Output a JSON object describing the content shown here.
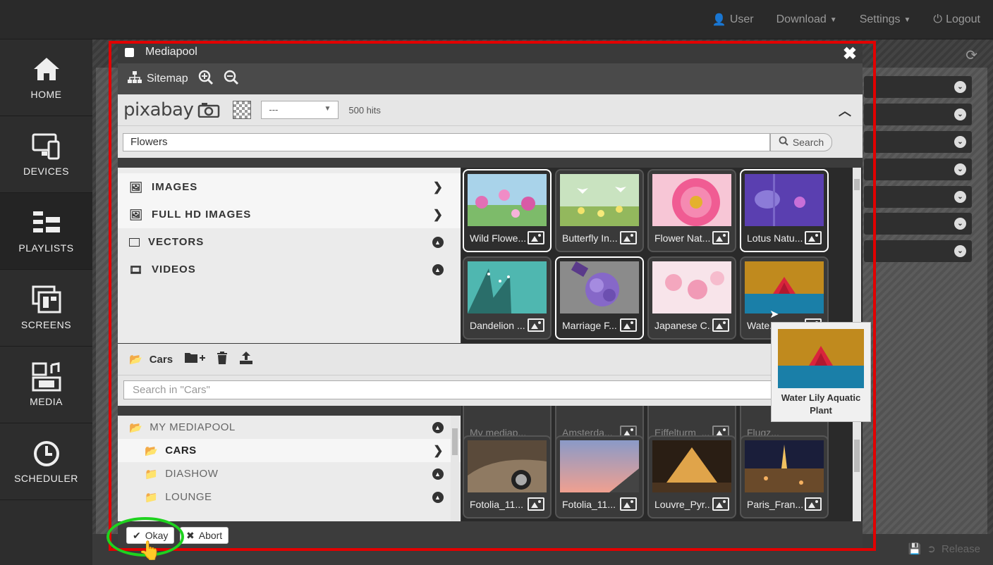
{
  "topnav": {
    "user": "User",
    "download": "Download",
    "settings": "Settings",
    "logout": "Logout"
  },
  "sidebar": {
    "items": [
      {
        "label": "HOME",
        "icon": "home-icon"
      },
      {
        "label": "DEVICES",
        "icon": "devices-icon"
      },
      {
        "label": "PLAYLISTS",
        "icon": "playlists-icon"
      },
      {
        "label": "SCREENS",
        "icon": "screens-icon"
      },
      {
        "label": "MEDIA",
        "icon": "media-icon"
      },
      {
        "label": "SCHEDULER",
        "icon": "scheduler-icon"
      }
    ],
    "active": "PLAYLISTS"
  },
  "modal": {
    "title": "Mediapool",
    "sitemap": "Sitemap",
    "provider": "pixabay",
    "select_value": "---",
    "hits": "500 hits",
    "search_value": "Flowers",
    "search_button": "Search",
    "categories": [
      {
        "label": "IMAGES",
        "icon": "image-icon",
        "state": "right"
      },
      {
        "label": "FULL HD IMAGES",
        "icon": "image-icon",
        "state": "right"
      },
      {
        "label": "VECTORS",
        "icon": "square-icon",
        "state": "up"
      },
      {
        "label": "VIDEOS",
        "icon": "film-icon",
        "state": "up"
      }
    ],
    "results": [
      {
        "label": "Wild Flowe...",
        "selected": true
      },
      {
        "label": "Butterfly In...",
        "selected": false
      },
      {
        "label": "Flower Nat...",
        "selected": false
      },
      {
        "label": "Lotus Natu...",
        "selected": true
      },
      {
        "label": "Dandelion ...",
        "selected": false
      },
      {
        "label": "Marriage F...",
        "selected": true
      },
      {
        "label": "Japanese C...",
        "selected": false
      },
      {
        "label": "Wate...",
        "selected": false
      }
    ],
    "folder_name": "Cars",
    "folder_search_placeholder": "Search in \"Cars\"",
    "tree": [
      {
        "label": "MY MEDIAPOOL",
        "level": 0,
        "state": "up"
      },
      {
        "label": "CARS",
        "level": 1,
        "state": "right",
        "active": true
      },
      {
        "label": "DIASHOW",
        "level": 1,
        "state": "up"
      },
      {
        "label": "LOUNGE",
        "level": 1,
        "state": "up"
      }
    ],
    "pool_partial": [
      "My mediap...",
      "Amsterda...",
      "Eiffelturm_...",
      "Flugz..."
    ],
    "pool_items": [
      "Fotolia_11...",
      "Fotolia_11...",
      "Louvre_Pyr...",
      "Paris_Fran..."
    ],
    "okay": "Okay",
    "abort": "Abort"
  },
  "tooltip": {
    "caption": "Water Lily Aquatic Plant"
  },
  "footer": {
    "release": "Release"
  }
}
